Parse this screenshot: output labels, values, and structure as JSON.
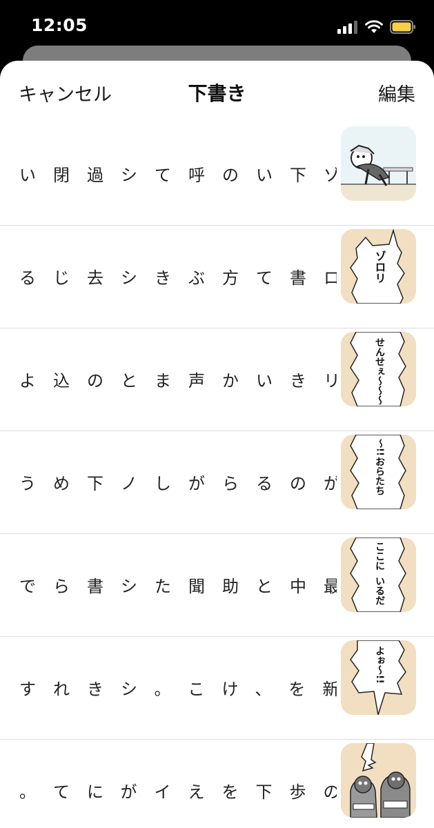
{
  "status_bar": {
    "time": "12:05",
    "icons": [
      "cellular-signal-icon",
      "wifi-icon",
      "battery-icon"
    ],
    "battery_color": "#f7d04a"
  },
  "nav": {
    "cancel_label": "キャンセル",
    "title": "下書き",
    "edit_label": "編集"
  },
  "drafts": [
    {
      "text": "い閉過シて呼のい下ゾ",
      "thumb": {
        "kind": "illustration",
        "bg": "#eaf4f7"
      }
    },
    {
      "text": "るじ去シきぶ方て書ロ",
      "thumb": {
        "kind": "speech-bubble",
        "caption": "ゾロリ",
        "bg": "#f2dec0"
      }
    },
    {
      "text": "よ込のとま声かいきリ",
      "thumb": {
        "kind": "speech-bubble",
        "caption": "せんせぇ〜〜〜",
        "bg": "#f2dec0"
      }
    },
    {
      "text": "うめ下ノしがらるのが",
      "thumb": {
        "kind": "speech-bubble",
        "caption": "おらたち",
        "caption2": "〜!!",
        "bg": "#f2dec0"
      }
    },
    {
      "text": "でら書シた聞助と中最",
      "thumb": {
        "kind": "speech-bubble",
        "caption": "ここに",
        "caption2": "いるだ",
        "bg": "#f2dec0"
      }
    },
    {
      "text": "すれきシ。こけ、を新",
      "thumb": {
        "kind": "speech-bubble",
        "caption": "よぉ〜!!",
        "bg": "#f2dec0"
      }
    },
    {
      "text": "。てにがイえを下歩の",
      "thumb": {
        "kind": "illustration-characters",
        "bg": "#f2dec0"
      }
    }
  ]
}
